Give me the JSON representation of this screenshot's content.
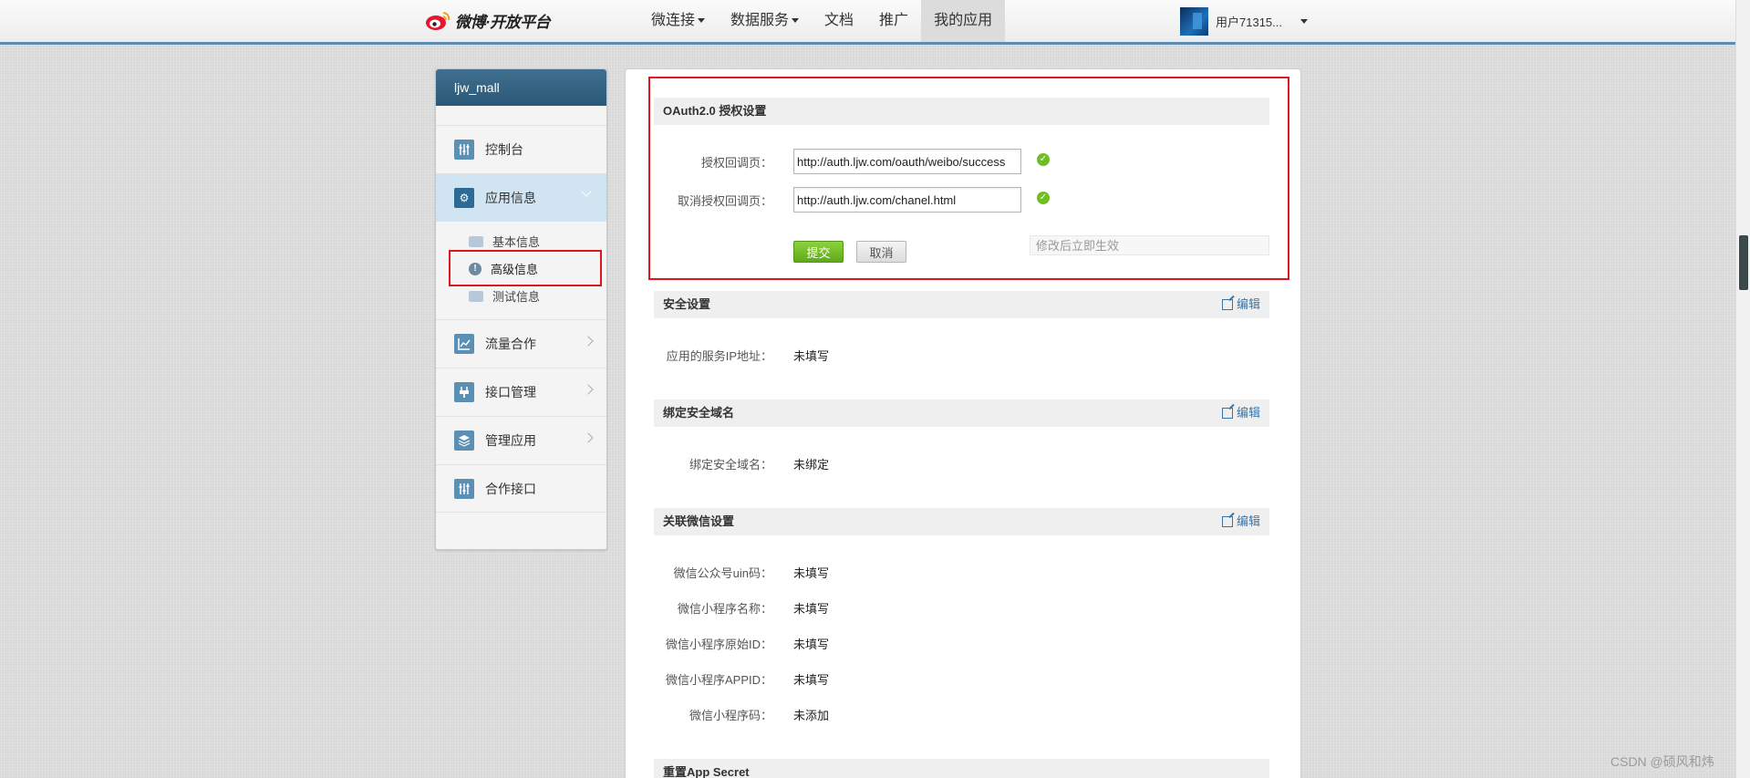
{
  "header": {
    "logo_text": "微博·开放平台",
    "nav": [
      {
        "label": "微连接",
        "dropdown": true
      },
      {
        "label": "数据服务",
        "dropdown": true
      },
      {
        "label": "文档",
        "dropdown": false
      },
      {
        "label": "推广",
        "dropdown": false
      },
      {
        "label": "我的应用",
        "dropdown": false,
        "active": true
      }
    ],
    "user_name": "用户71315..."
  },
  "sidebar": {
    "app_name": "ljw_mall",
    "items": [
      {
        "label": "控制台",
        "icon": "sliders-icon"
      },
      {
        "label": "应用信息",
        "icon": "gear-icon",
        "active": true
      },
      {
        "label": "流量合作",
        "icon": "chart-icon"
      },
      {
        "label": "接口管理",
        "icon": "plug-icon"
      },
      {
        "label": "管理应用",
        "icon": "layers-icon"
      },
      {
        "label": "合作接口",
        "icon": "sliders-icon"
      }
    ],
    "sub_items": [
      {
        "label": "基本信息",
        "icon": "card-icon"
      },
      {
        "label": "高级信息",
        "icon": "info-icon",
        "active": true
      },
      {
        "label": "测试信息",
        "icon": "image-icon"
      }
    ]
  },
  "oauth": {
    "title": "OAuth2.0 授权设置",
    "callback_label": "授权回调页：",
    "callback_value": "http://auth.ljw.com/oauth/weibo/success",
    "cancel_callback_label": "取消授权回调页：",
    "cancel_callback_value": "http://auth.ljw.com/chanel.html",
    "submit_label": "提交",
    "cancel_label": "取消",
    "hint": "修改后立即生效"
  },
  "security": {
    "title": "安全设置",
    "edit_label": "编辑",
    "ip_label": "应用的服务IP地址：",
    "ip_value": "未填写"
  },
  "domain": {
    "title": "绑定安全域名",
    "edit_label": "编辑",
    "label": "绑定安全域名：",
    "value": "未绑定"
  },
  "wechat": {
    "title": "关联微信设置",
    "edit_label": "编辑",
    "rows": [
      {
        "label": "微信公众号uin码：",
        "value": "未填写"
      },
      {
        "label": "微信小程序名称：",
        "value": "未填写"
      },
      {
        "label": "微信小程序原始ID：",
        "value": "未填写"
      },
      {
        "label": "微信小程序APPID：",
        "value": "未填写"
      },
      {
        "label": "微信小程序码：",
        "value": "未添加"
      }
    ]
  },
  "reset": {
    "title": "重置App Secret"
  },
  "watermark": "CSDN @硕风和炜",
  "colors": {
    "accent_blue": "#2c5877",
    "highlight_red": "#e0141e",
    "submit_green": "#5ea91b"
  }
}
